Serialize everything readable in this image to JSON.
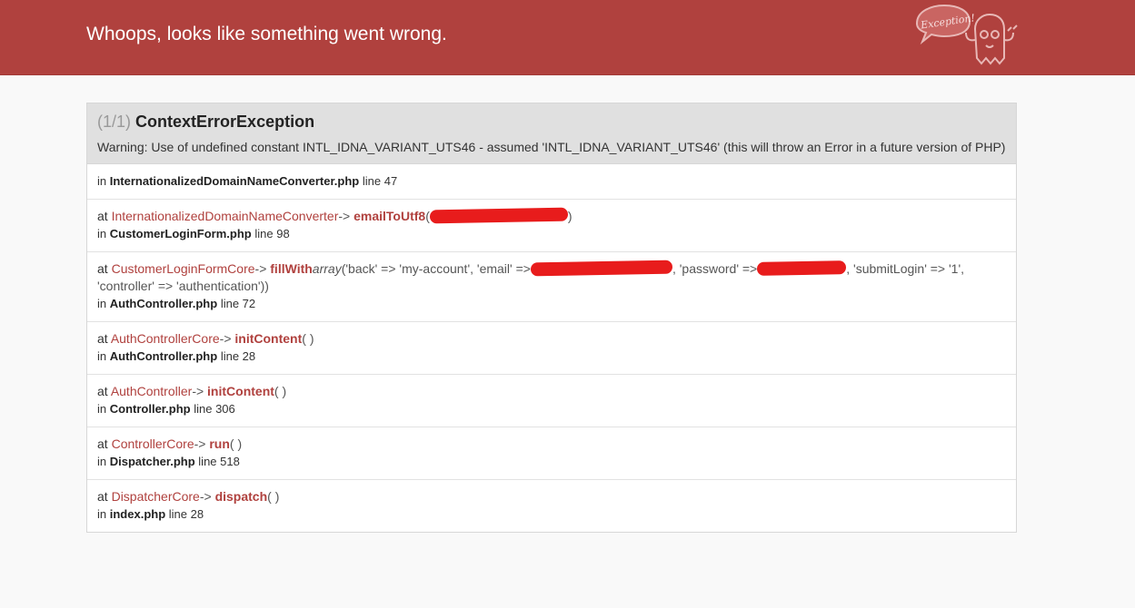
{
  "header": {
    "title": "Whoops, looks like something went wrong.",
    "logo_text": "Exception!",
    "background": "#b0413e"
  },
  "exception": {
    "count": "(1/1)",
    "class": "ContextErrorException",
    "message": "Warning: Use of undefined constant INTL_IDNA_VARIANT_UTS46 - assumed 'INTL_IDNA_VARIANT_UTS46' (this will throw an Error in a future version of PHP)"
  },
  "trace": {
    "origin": {
      "in": "in",
      "file": "InternationalizedDomainNameConverter.php",
      "line": "line 47"
    },
    "frames": [
      {
        "at": "at",
        "class": "InternationalizedDomainNameConverter",
        "arrow": "->",
        "method": "emailToUtf8",
        "open": "(",
        "close": ")",
        "in": "in",
        "file": "CustomerLoginForm.php",
        "line": "line 98"
      },
      {
        "at": "at",
        "class": "CustomerLoginFormCore",
        "arrow": "->",
        "method": "fillWith",
        "open": "(",
        "array_kw": "array",
        "args_a": "('back' => 'my-account', 'email' =>",
        "args_b": ", 'password' =>",
        "args_c": ", 'submitLogin' => '1', 'controller' => 'authentication'))",
        "in": "in",
        "file": "AuthController.php",
        "line": "line 72"
      },
      {
        "at": "at",
        "class": "AuthControllerCore",
        "arrow": "->",
        "method": "initContent",
        "args": "( )",
        "in": "in",
        "file": "AuthController.php",
        "line": "line 28"
      },
      {
        "at": "at",
        "class": "AuthController",
        "arrow": "->",
        "method": "initContent",
        "args": "( )",
        "in": "in",
        "file": "Controller.php",
        "line": "line 306"
      },
      {
        "at": "at",
        "class": "ControllerCore",
        "arrow": "->",
        "method": "run",
        "args": "( )",
        "in": "in",
        "file": "Dispatcher.php",
        "line": "line 518"
      },
      {
        "at": "at",
        "class": "DispatcherCore",
        "arrow": "->",
        "method": "dispatch",
        "args": "( )",
        "in": "in",
        "file": "index.php",
        "line": "line 28"
      }
    ]
  },
  "colors": {
    "accent": "#b0413e",
    "redaction": "#e81c1c",
    "page": "#f9f9f9"
  }
}
